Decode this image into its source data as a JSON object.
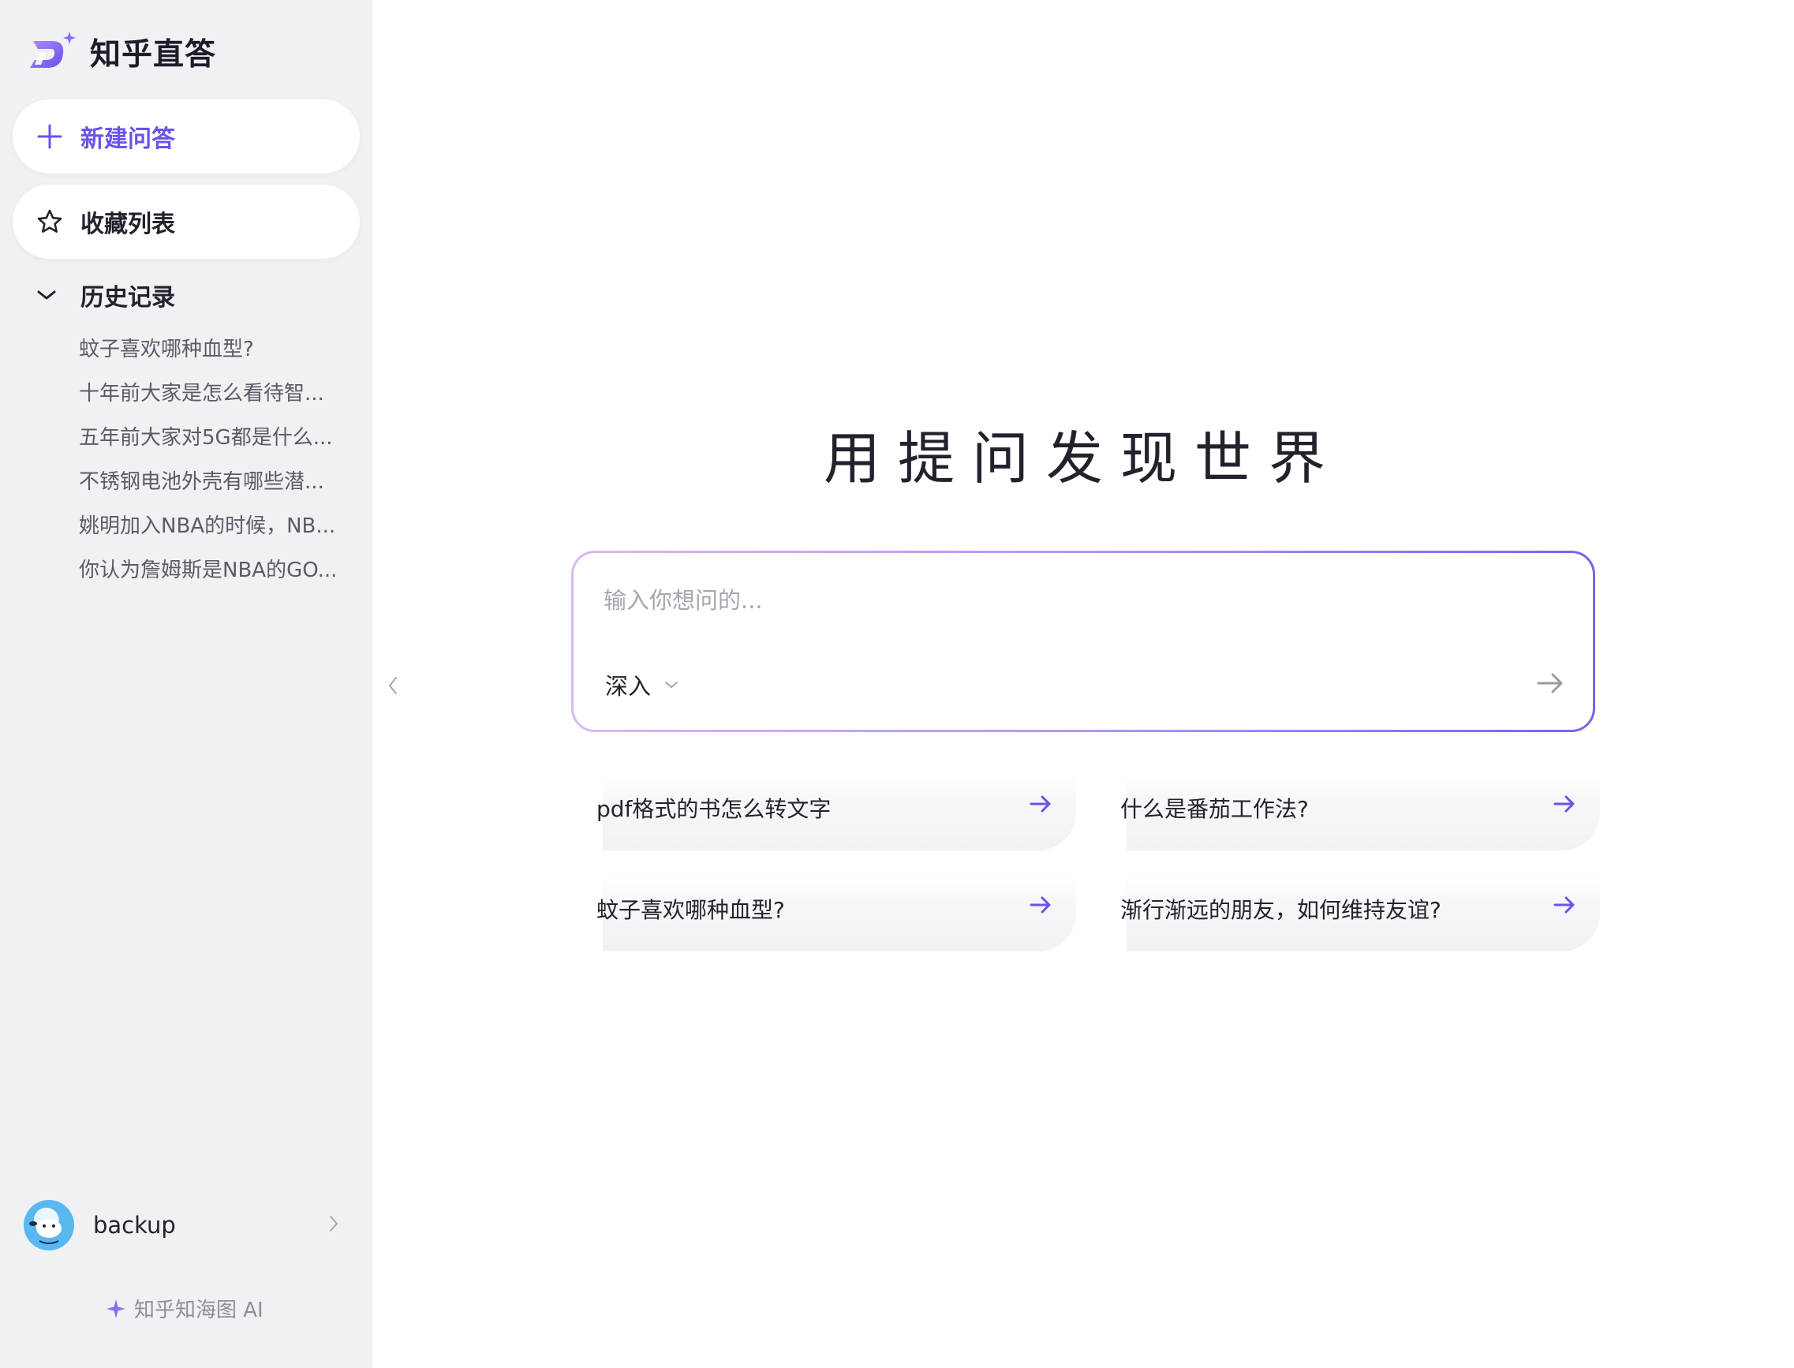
{
  "app": {
    "name": "知乎直答",
    "brand_color": "#6b53e8",
    "logo_icon": "zhida-logo-icon"
  },
  "sidebar": {
    "new_button": {
      "label": "新建问答",
      "icon": "plus-icon"
    },
    "favorites_button": {
      "label": "收藏列表",
      "icon": "star-icon"
    },
    "history": {
      "label": "历史记录",
      "icon": "chevron-down-icon",
      "items": [
        {
          "label": "蚊子喜欢哪种血型?"
        },
        {
          "label": "十年前大家是怎么看待智..."
        },
        {
          "label": "五年前大家对5G都是什么..."
        },
        {
          "label": "不锈钢电池外壳有哪些潜..."
        },
        {
          "label": "姚明加入NBA的时候，NB..."
        },
        {
          "label": "你认为詹姆斯是NBA的GO..."
        }
      ]
    },
    "user": {
      "name": "backup",
      "icon": "chevron-right-icon"
    },
    "footer": {
      "label": "知乎知海图 AI",
      "icon": "sparkle-icon"
    }
  },
  "main": {
    "title": "用提问发现世界",
    "input": {
      "placeholder": "输入你想问的...",
      "value": ""
    },
    "mode": {
      "label": "深入",
      "icon": "chevron-down-icon"
    },
    "send_icon": "arrow-right-icon",
    "suggestions": [
      {
        "label": "pdf格式的书怎么转文字"
      },
      {
        "label": "什么是番茄工作法?"
      },
      {
        "label": "蚊子喜欢哪种血型?"
      },
      {
        "label": "渐行渐远的朋友，如何维持友谊?"
      }
    ]
  }
}
